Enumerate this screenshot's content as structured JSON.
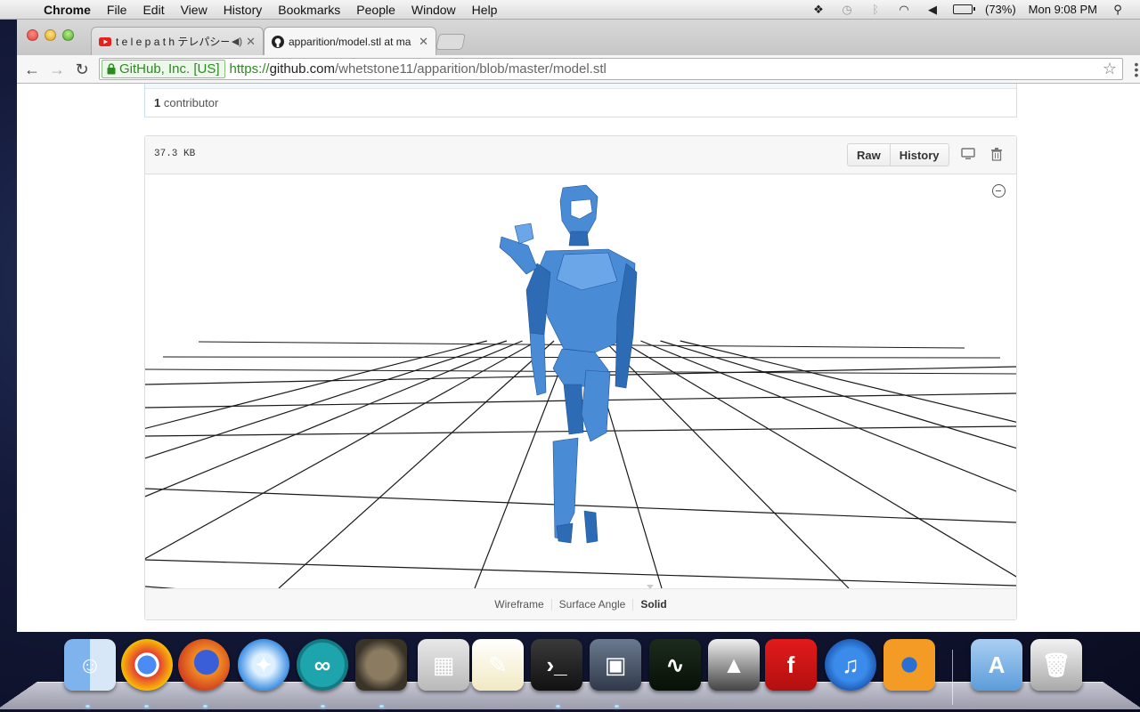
{
  "menubar": {
    "app_name": "Chrome",
    "items": [
      "File",
      "Edit",
      "View",
      "History",
      "Bookmarks",
      "People",
      "Window",
      "Help"
    ],
    "battery": "(73%)",
    "clock": "Mon 9:08 PM"
  },
  "browser": {
    "tabs": [
      {
        "title": "t e l e p a t h テレパシー",
        "favicon": "youtube-icon",
        "audio": true
      },
      {
        "title": "apparition/model.stl at ma",
        "favicon": "github-icon",
        "active": true
      }
    ],
    "ev_label": "GitHub, Inc. [US]",
    "url": {
      "scheme": "https://",
      "host": "github.com",
      "path": "/whetstone11/apparition/blob/master/model.stl"
    }
  },
  "page": {
    "contributors_count": "1",
    "contributors_label": "contributor",
    "file_size": "37.3 KB",
    "buttons": {
      "raw": "Raw",
      "history": "History"
    },
    "view_modes": [
      "Wireframe",
      "Surface Angle",
      "Solid"
    ],
    "active_view_mode": "Solid",
    "model_color": "#4a8bd6",
    "grid_color": "#1a1a1a"
  },
  "dock": {
    "apps": [
      "Finder",
      "Chrome",
      "Firefox",
      "Safari",
      "Arduino",
      "GIMP",
      "Calculator",
      "TextEdit",
      "Terminal",
      "Mission Control",
      "Activity Monitor",
      "Inkscape",
      "FileZilla",
      "iTunes",
      "Blender",
      "Applications",
      "Trash"
    ]
  }
}
